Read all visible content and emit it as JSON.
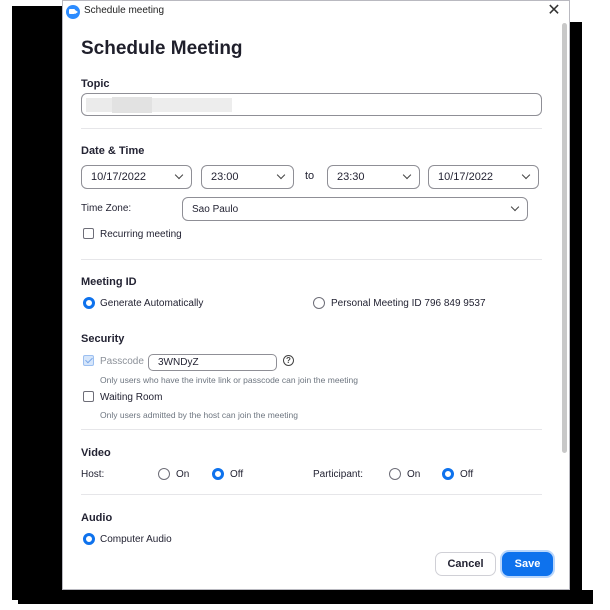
{
  "window": {
    "title": "Schedule meeting",
    "close_symbol": "✕"
  },
  "heading": "Schedule Meeting",
  "topic": {
    "label": "Topic",
    "value": ""
  },
  "date_time": {
    "label": "Date & Time",
    "start_date": "10/17/2022",
    "start_time": "23:00",
    "to_label": "to",
    "end_time": "23:30",
    "end_date": "10/17/2022",
    "timezone_label": "Time Zone:",
    "timezone_value": "Sao Paulo",
    "recurring_label": "Recurring meeting"
  },
  "meeting_id": {
    "label": "Meeting ID",
    "generate_label": "Generate Automatically",
    "personal_label": "Personal Meeting ID 796 849 9537",
    "selected": "generate"
  },
  "security": {
    "label": "Security",
    "passcode_label": "Passcode",
    "passcode_value": "3WNDyZ",
    "help_symbol": "?",
    "passcode_hint": "Only users who have the invite link or passcode can join the meeting",
    "waiting_room_label": "Waiting Room",
    "waiting_room_hint": "Only users admitted by the host can join the meeting"
  },
  "video": {
    "label": "Video",
    "host_label": "Host:",
    "participant_label": "Participant:",
    "on_label": "On",
    "off_label": "Off",
    "host_selected": "off",
    "participant_selected": "off"
  },
  "audio": {
    "label": "Audio",
    "computer_audio_label": "Computer Audio"
  },
  "buttons": {
    "cancel": "Cancel",
    "save": "Save"
  },
  "colors": {
    "accent": "#0e72ed",
    "app_icon": "#2d8cff"
  }
}
